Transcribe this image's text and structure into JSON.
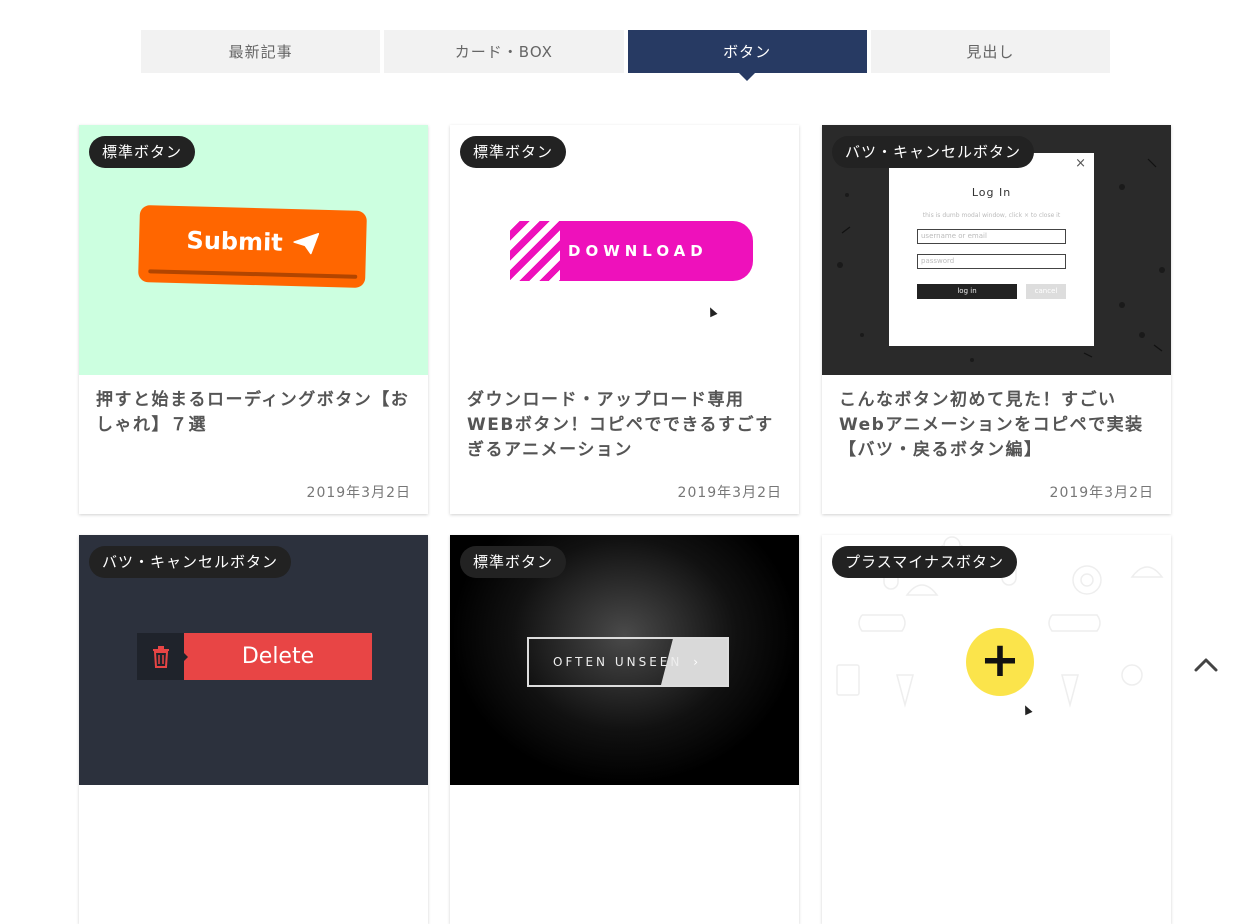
{
  "tabs": [
    {
      "label": "最新記事",
      "active": false
    },
    {
      "label": "カード・BOX",
      "active": false
    },
    {
      "label": "ボタン",
      "active": true
    },
    {
      "label": "見出し",
      "active": false
    }
  ],
  "cards": [
    {
      "badge": "標準ボタン",
      "title": "押すと始まるローディングボタン【おしゃれ】７選",
      "date": "2019年3月2日",
      "preview": {
        "button_label": "Submit",
        "bg": "#ccffe0",
        "button_color": "#ff6600"
      }
    },
    {
      "badge": "標準ボタン",
      "title": "ダウンロード・アップロード専用WEBボタン！コピペでできるすごすぎるアニメーション",
      "date": "2019年3月2日",
      "preview": {
        "button_label": "DOWNLOAD",
        "button_color": "#ee11bb"
      }
    },
    {
      "badge": "バツ・キャンセルボタン",
      "title": "こんなボタン初めて見た！すごいWebアニメーションをコピペで実装【バツ・戻るボタン編】",
      "date": "2019年3月2日",
      "preview": {
        "close": "×",
        "heading": "Log In",
        "subtext": "this is dumb modal window, click × to close it",
        "username_placeholder": "username or email",
        "password_placeholder": "password",
        "login_label": "log in",
        "cancel_label": "cancel"
      }
    },
    {
      "badge": "バツ・キャンセルボタン",
      "title": "",
      "date": "",
      "preview": {
        "button_label": "Delete",
        "icon": "trash-icon",
        "button_color": "#e84545"
      }
    },
    {
      "badge": "標準ボタン",
      "title": "",
      "date": "",
      "preview": {
        "button_label": "OFTEN UNSEEN",
        "arrow": "›"
      }
    },
    {
      "badge": "プラスマイナスボタン",
      "title": "",
      "date": "",
      "preview": {
        "symbol": "+",
        "button_color": "#fbe44b"
      }
    }
  ],
  "page_top": {
    "icon": "chevron-up-icon"
  },
  "colors": {
    "active_tab": "#273a63",
    "badge": "#222222"
  }
}
